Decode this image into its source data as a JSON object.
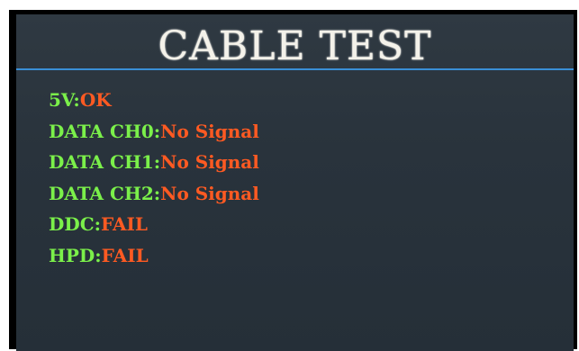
{
  "screen": {
    "title": "CABLE TEST",
    "colors": {
      "background": "#2b353e",
      "title": "#f4f2ea",
      "divider": "#3a8fd6",
      "label": "#7bf04a",
      "value": "#ff5a22"
    }
  },
  "results": [
    {
      "label": "5V:",
      "value": "OK"
    },
    {
      "label": "DATA CH0:",
      "value": "No Signal"
    },
    {
      "label": "DATA CH1:",
      "value": "No Signal"
    },
    {
      "label": "DATA CH2:",
      "value": "No Signal"
    },
    {
      "label": "DDC:",
      "value": "FAIL"
    },
    {
      "label": "HPD:",
      "value": "FAIL"
    }
  ]
}
